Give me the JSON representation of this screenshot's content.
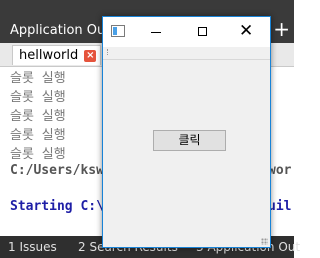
{
  "background_ide": {
    "pane_title": "Application Outp",
    "plus_label": "+",
    "tab_label": "hellworld",
    "output_lines": [
      "슬롯 실행",
      "슬롯 실행",
      "슬롯 실행",
      "슬롯 실행",
      "슬롯 실행"
    ],
    "path_line_left": "C:/Users/ksw",
    "path_line_right": "wor",
    "starting_left": "Starting C:\\",
    "starting_right": "uil",
    "bottom_items": [
      "1 Issues",
      "2 Search Results",
      "3 Application Out"
    ]
  },
  "app_window": {
    "button_label": "클릭"
  },
  "colors": {
    "accent_border": "#1883d7",
    "ide_dark": "#3a3a3a",
    "output_blue": "#1e1ea6"
  }
}
